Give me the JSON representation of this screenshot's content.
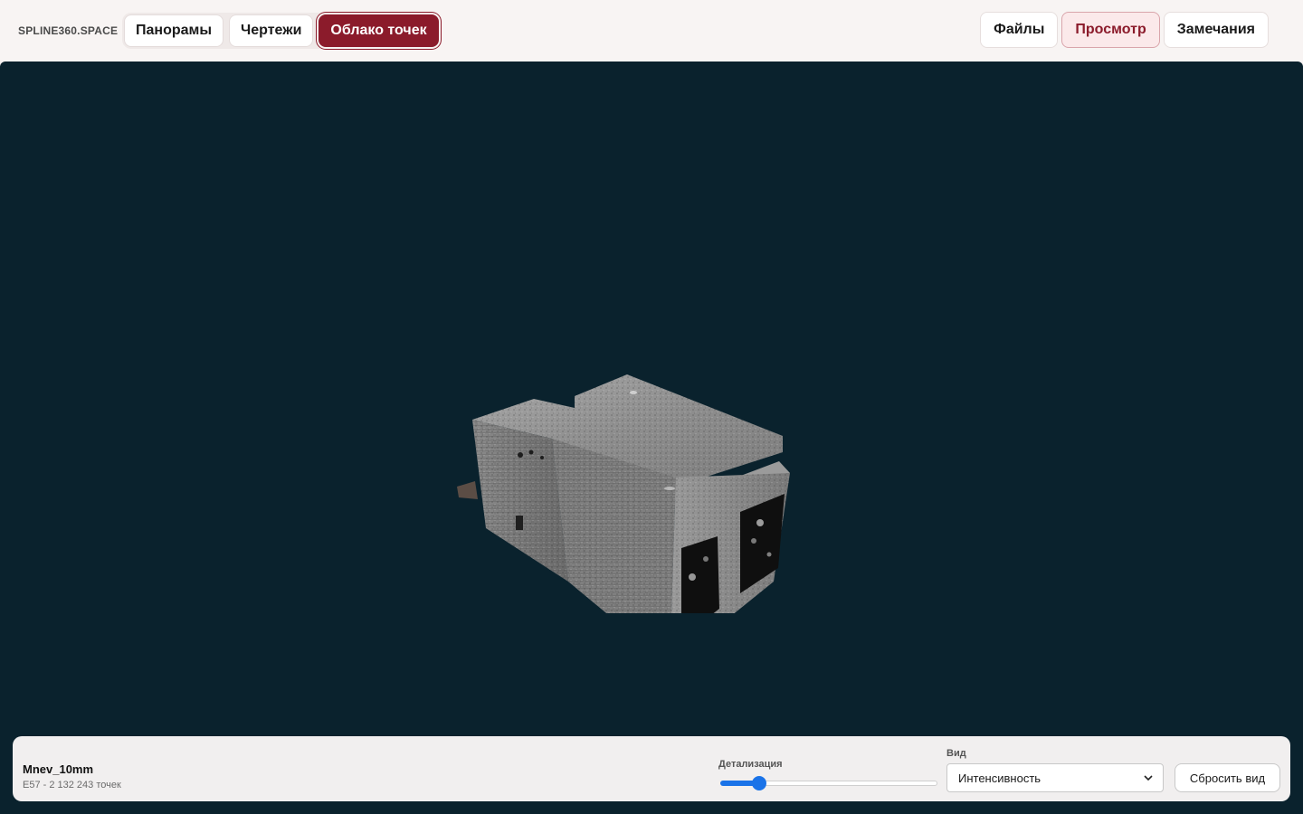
{
  "header": {
    "brand": "SPLINE360.SPACE",
    "tabs": [
      {
        "label": "Панорамы",
        "active": false
      },
      {
        "label": "Чертежи",
        "active": false
      },
      {
        "label": "Облако точек",
        "active": true
      }
    ],
    "actions": [
      {
        "label": "Файлы",
        "active": false
      },
      {
        "label": "Просмотр",
        "active": true
      },
      {
        "label": "Замечания",
        "active": false
      }
    ]
  },
  "viewer": {
    "background": "#0a222d"
  },
  "panel": {
    "file_name": "Mnev_10mm",
    "file_meta": "E57 - 2 132 243 точек",
    "detail_label": "Детализация",
    "detail_value": 0.18,
    "view_label": "Вид",
    "view_selected": "Интенсивность",
    "reset_label": "Сбросить вид"
  },
  "colors": {
    "accent": "#8b1b2b",
    "accent_light": "#fbe9ea",
    "slider": "#1a73e8"
  }
}
